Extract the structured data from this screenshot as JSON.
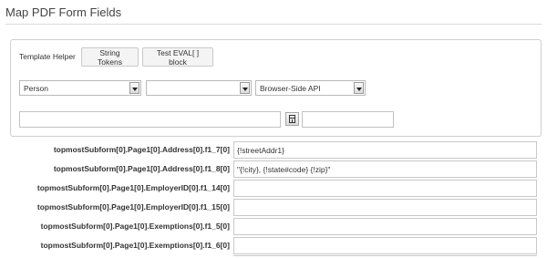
{
  "page": {
    "title": "Map PDF Form Fields"
  },
  "helper": {
    "label": "Template Helper",
    "string_tokens_label": "String Tokens",
    "test_eval_label": "Test EVAL[ ] block",
    "select_entity": "Person",
    "select_field": "",
    "select_api": "Browser-Side API",
    "input_expression": "",
    "input_result": "",
    "calc_icon": "calculator-icon"
  },
  "fields": [
    {
      "label": "topmostSubform[0].Page1[0].Address[0].f1_7[0]",
      "value": "{!streetAddr1}"
    },
    {
      "label": "topmostSubform[0].Page1[0].Address[0].f1_8[0]",
      "value": "\"{!city}, {!state#code} {!zip}\""
    },
    {
      "label": "topmostSubform[0].Page1[0].EmployerID[0].f1_14[0]",
      "value": ""
    },
    {
      "label": "topmostSubform[0].Page1[0].EmployerID[0].f1_15[0]",
      "value": ""
    },
    {
      "label": "topmostSubform[0].Page1[0].Exemptions[0].f1_5[0]",
      "value": ""
    },
    {
      "label": "topmostSubform[0].Page1[0].Exemptions[0].f1_6[0]",
      "value": ""
    }
  ]
}
